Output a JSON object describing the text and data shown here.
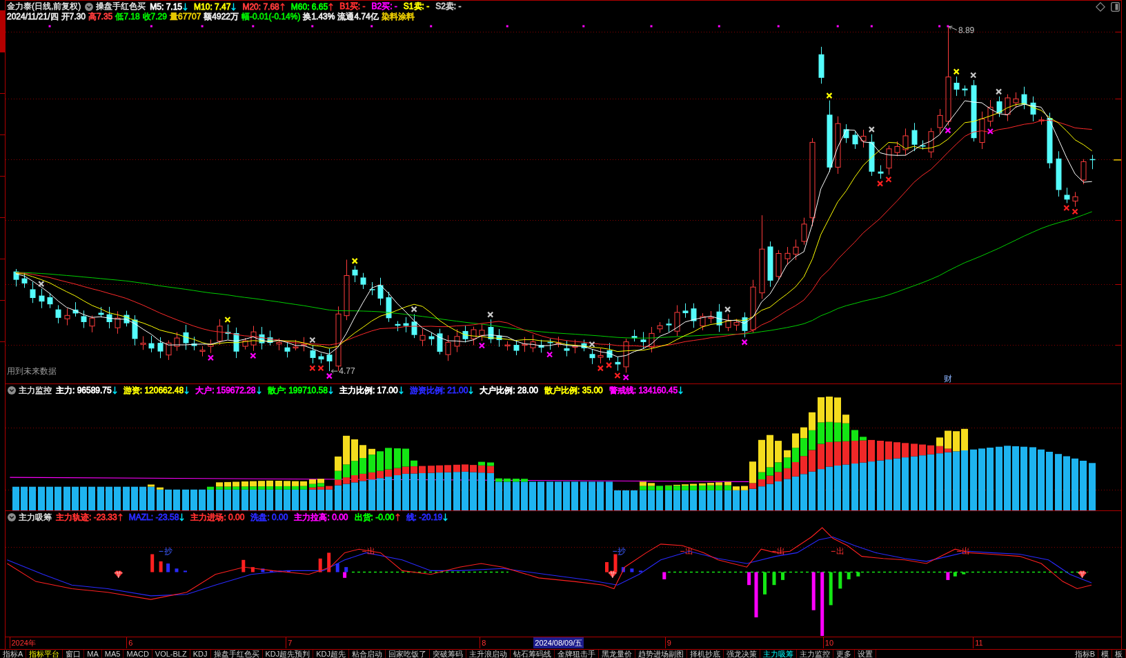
{
  "side_tabs": [
    {
      "selected": false
    },
    {
      "selected": true
    },
    {
      "selected": false
    },
    {
      "selected": false
    },
    {
      "selected": false
    },
    {
      "selected": false
    },
    {
      "selected": false
    },
    {
      "selected": false
    },
    {
      "selected": false
    }
  ],
  "main_panel": {
    "title": "金力泰(日线,前复权)",
    "indicator": "操盘手红色买",
    "legend": [
      {
        "label": "M5: 7.15",
        "color": "#ffffff",
        "up": false,
        "down": true
      },
      {
        "label": "M10: 7.47",
        "color": "#ffff00",
        "up": false,
        "down": true
      },
      {
        "label": "M20: 7.68",
        "color": "#ff3c3c",
        "up": true,
        "down": false
      },
      {
        "label": "M60: 6.65",
        "color": "#00ff00",
        "up": true,
        "down": false
      },
      {
        "label": "B1买: -",
        "color": "#ff3030",
        "up": false,
        "down": false
      },
      {
        "label": "B2买: -",
        "color": "#ff00ff",
        "up": false,
        "down": false
      },
      {
        "label": "S1卖: -",
        "color": "#ffff00",
        "up": false,
        "down": false
      },
      {
        "label": "S2卖: -",
        "color": "#c8c8c8",
        "up": false,
        "down": false
      }
    ],
    "quote": [
      {
        "text": "2024/11/21/四",
        "color": "#e6e6e6"
      },
      {
        "text": "开7.30",
        "color": "#e6e6e6"
      },
      {
        "text": "高7.35",
        "color": "#ff3c3c"
      },
      {
        "text": "低7.18",
        "color": "#00e600"
      },
      {
        "text": "收7.29",
        "color": "#00e600"
      },
      {
        "text": "量67707",
        "color": "#e6c800"
      },
      {
        "text": "额4922万",
        "color": "#e6e6e6"
      },
      {
        "text": "幅-0.01(-0.14%)",
        "color": "#00e600"
      },
      {
        "text": "换1.43%",
        "color": "#e6e6e6"
      },
      {
        "text": "流通4.74亿",
        "color": "#e6e6e6"
      },
      {
        "text": "染料涂料",
        "color": "#e6c800"
      }
    ],
    "high_label": "8.89",
    "low_label": "4.77",
    "notice": "用到未来数据",
    "event_tag": "财"
  },
  "monitor_panel": {
    "title": "主力监控",
    "legend": [
      {
        "label": "主力: 96589.75",
        "color": "#ffffff",
        "up": false,
        "down": true
      },
      {
        "label": "游资: 120662.48",
        "color": "#ffff00",
        "up": false,
        "down": true
      },
      {
        "label": "大户: 159672.28",
        "color": "#ff00ff",
        "up": false,
        "down": true
      },
      {
        "label": "散户: 199710.58",
        "color": "#00ff00",
        "up": false,
        "down": true
      },
      {
        "label": "主力比例: 17.00",
        "color": "#ffffff",
        "up": false,
        "down": true
      },
      {
        "label": "游资比例: 21.00",
        "color": "#2a2aff",
        "up": false,
        "down": true
      },
      {
        "label": "大户比例: 28.00",
        "color": "#ffffff",
        "up": false,
        "down": false
      },
      {
        "label": "散户比例: 35.00",
        "color": "#ffff00",
        "up": false,
        "down": false
      },
      {
        "label": "警戒线: 134160.45",
        "color": "#ff00ff",
        "up": false,
        "down": true
      }
    ]
  },
  "accumulation_panel": {
    "title": "主力吸筹",
    "legend": [
      {
        "label": "主力轨迹: -23.33",
        "color": "#ff3030",
        "up": true,
        "down": false
      },
      {
        "label": "MAZL: -23.58",
        "color": "#2a2aff",
        "up": false,
        "down": true
      },
      {
        "label": "主力进场: 0.00",
        "color": "#ff3030",
        "up": false,
        "down": false
      },
      {
        "label": "洗盘: 0.00",
        "color": "#2a2aff",
        "up": false,
        "down": false
      },
      {
        "label": "主力拉高: 0.00",
        "color": "#ff00ff",
        "up": false,
        "down": false
      },
      {
        "label": "出货: -0.00",
        "color": "#00ff00",
        "up": true,
        "down": false
      },
      {
        "label": "线: -20.19",
        "color": "#2a2aff",
        "up": false,
        "down": true
      }
    ],
    "signals": [
      {
        "label": "抄",
        "kind": "buy"
      },
      {
        "label": "出",
        "kind": "sell"
      },
      {
        "label": "抄",
        "kind": "buy"
      },
      {
        "label": "出",
        "kind": "sell"
      },
      {
        "label": "出",
        "kind": "sell"
      },
      {
        "label": "出",
        "kind": "sell"
      },
      {
        "label": "出",
        "kind": "sell"
      }
    ]
  },
  "date_axis": [
    {
      "label": "2024年",
      "kind": "tick"
    },
    {
      "label": "6",
      "kind": "tick"
    },
    {
      "label": "7",
      "kind": "tick"
    },
    {
      "label": "8",
      "kind": "tick"
    },
    {
      "label": "2024/08/09/五",
      "kind": "cursor"
    },
    {
      "label": "9",
      "kind": "tick"
    },
    {
      "label": "10",
      "kind": "tick"
    },
    {
      "label": "11",
      "kind": "tick"
    }
  ],
  "bottom_tabs": [
    {
      "label": "指标A",
      "kind": "tab",
      "selected": false
    },
    {
      "label": "指标平台",
      "kind": "platform",
      "selected": false
    },
    {
      "label": "窗口",
      "kind": "tab",
      "selected": false
    },
    {
      "label": "MA",
      "kind": "tab",
      "selected": false
    },
    {
      "label": "MA5",
      "kind": "tab",
      "selected": false
    },
    {
      "label": "MACD",
      "kind": "tab",
      "selected": false
    },
    {
      "label": "VOL-BLZ",
      "kind": "tab",
      "selected": false
    },
    {
      "label": "KDJ",
      "kind": "tab",
      "selected": false
    },
    {
      "label": "操盘手红色买",
      "kind": "tab",
      "selected": false
    },
    {
      "label": "KDJ超先预判",
      "kind": "tab",
      "selected": false
    },
    {
      "label": "KDJ超先",
      "kind": "tab",
      "selected": false
    },
    {
      "label": "粘合启动",
      "kind": "tab",
      "selected": false
    },
    {
      "label": "回家吃饭了",
      "kind": "tab",
      "selected": false
    },
    {
      "label": "突破筹码",
      "kind": "tab",
      "selected": false
    },
    {
      "label": "主升浪启动",
      "kind": "tab",
      "selected": false
    },
    {
      "label": "钻石筹码线",
      "kind": "tab",
      "selected": false
    },
    {
      "label": "金牌狙击手",
      "kind": "tab",
      "selected": false
    },
    {
      "label": "黑龙量价",
      "kind": "tab",
      "selected": false
    },
    {
      "label": "趋势进场副图",
      "kind": "tab",
      "selected": false
    },
    {
      "label": "择机抄底",
      "kind": "tab",
      "selected": false
    },
    {
      "label": "强龙决策",
      "kind": "tab",
      "selected": false
    },
    {
      "label": "主力吸筹",
      "kind": "tab",
      "selected": true
    },
    {
      "label": "主力监控",
      "kind": "tab",
      "selected": false
    },
    {
      "label": "更多",
      "kind": "tab",
      "selected": false
    },
    {
      "label": "设置",
      "kind": "tab",
      "selected": false
    }
  ],
  "bottom_right_tabs": [
    {
      "label": "指标B",
      "kind": "tab",
      "selected": false
    },
    {
      "label": "模",
      "kind": "tab",
      "selected": false
    },
    {
      "label": "板",
      "kind": "tab",
      "selected": false
    }
  ]
}
